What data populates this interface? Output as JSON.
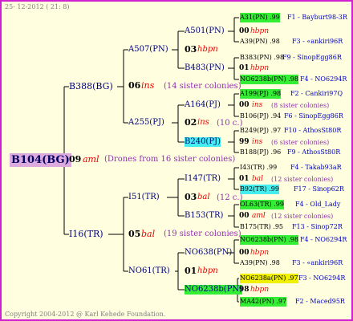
{
  "date": "25- 12-2012 ( 21:  8)",
  "copyright": "Copyright 2004-2012 @ Karl Kehede Foundation.",
  "root": {
    "id": "B104(BG)",
    "gen": "09",
    "race": "aml",
    "note": "(Drones from 16 sister colonies)"
  },
  "level1": [
    {
      "id": "B388(BG)",
      "gen": "06",
      "race": "ins",
      "note": "(14 sister colonies)"
    },
    {
      "id": "I16(TR)",
      "gen": "05",
      "race": "bal",
      "note": "(19 sister colonies)"
    }
  ],
  "level2": [
    {
      "id": "A507(PN)",
      "gen": "03",
      "race": "hbpn",
      "note": ""
    },
    {
      "id": "A255(PJ)",
      "gen": "02",
      "race": "ins",
      "note": "(10 c.)"
    },
    {
      "id": "I51(TR)",
      "gen": "03",
      "race": "bal",
      "note": "(12 c.)"
    },
    {
      "id": "NO61(TR)",
      "gen": "01",
      "race": "hbpn",
      "note": ""
    }
  ],
  "level3": [
    {
      "id": "A501(PN)",
      "gen": "00",
      "race": "hbpn",
      "note": ""
    },
    {
      "id": "B483(PN)",
      "gen": "01",
      "race": "hbpn",
      "note": ""
    },
    {
      "id": "A164(PJ)",
      "gen": "00",
      "race": "ins",
      "note": "(8 sister colonies)"
    },
    {
      "id": "B240(PJ)",
      "gen": "99",
      "race": "ins",
      "note": "(6 sister colonies)"
    },
    {
      "id": "I147(TR)",
      "gen": "01",
      "race": "bal",
      "note": "(12 sister colonies)"
    },
    {
      "id": "B153(TR)",
      "gen": "00",
      "race": "aml",
      "note": "(12 sister colonies)"
    },
    {
      "id": "NO638(PN)",
      "gen": "00",
      "race": "hbpn",
      "note": ""
    },
    {
      "id": "NO6238b(PN)",
      "gen": "98",
      "race": "hbpn",
      "note": ""
    }
  ],
  "level4": [
    {
      "id": "A31(PN) .99",
      "info": "F1 - Bayburt98-3R"
    },
    {
      "id": "A39(PN) .98",
      "info": "F3 - «ankiri96R"
    },
    {
      "id": "B383(PN) .98",
      "info": "F9 - SinopEgg86R"
    },
    {
      "id": "NO6238b(PN) .98",
      "info": "F4 - NO6294R"
    },
    {
      "id": "A199(PJ) .98",
      "info": "F2 - Cankiri97Q"
    },
    {
      "id": "B106(PJ) .94",
      "info": "F6 - SinopEgg86R"
    },
    {
      "id": "B249(PJ) .97",
      "info": "F10 - AthosSt80R"
    },
    {
      "id": "B188(PJ) .96",
      "info": "F9 - AthosSt80R"
    },
    {
      "id": "I43(TR) .99",
      "info": "F4 - Takab93aR"
    },
    {
      "id": "B92(TR) .99",
      "info": "F17 - Sinop62R"
    },
    {
      "id": "OL63(TR) .99",
      "info": "F4 - Old_Lady"
    },
    {
      "id": "B175(TR) .95",
      "info": "F13 - Sinop72R"
    },
    {
      "id": "NO6238b(PN) .98",
      "info": "F4 - NO6294R"
    },
    {
      "id": "A39(PN) .98",
      "info": "F3 - «ankiri96R"
    },
    {
      "id": "NO6238a(PN) .97",
      "info": "F3 - NO6294R"
    },
    {
      "id": "MA42(PN) .97",
      "info": "F2 - Maced95R"
    }
  ],
  "colors": {
    "border": "#d020d0",
    "background": "#ffffe0",
    "race": "#ee0000",
    "note": "#9030b0",
    "info": "#0000c0",
    "green_highlight": "#33ee33",
    "cyan_highlight": "#44eeee",
    "yellow_highlight": "#f0f000"
  }
}
